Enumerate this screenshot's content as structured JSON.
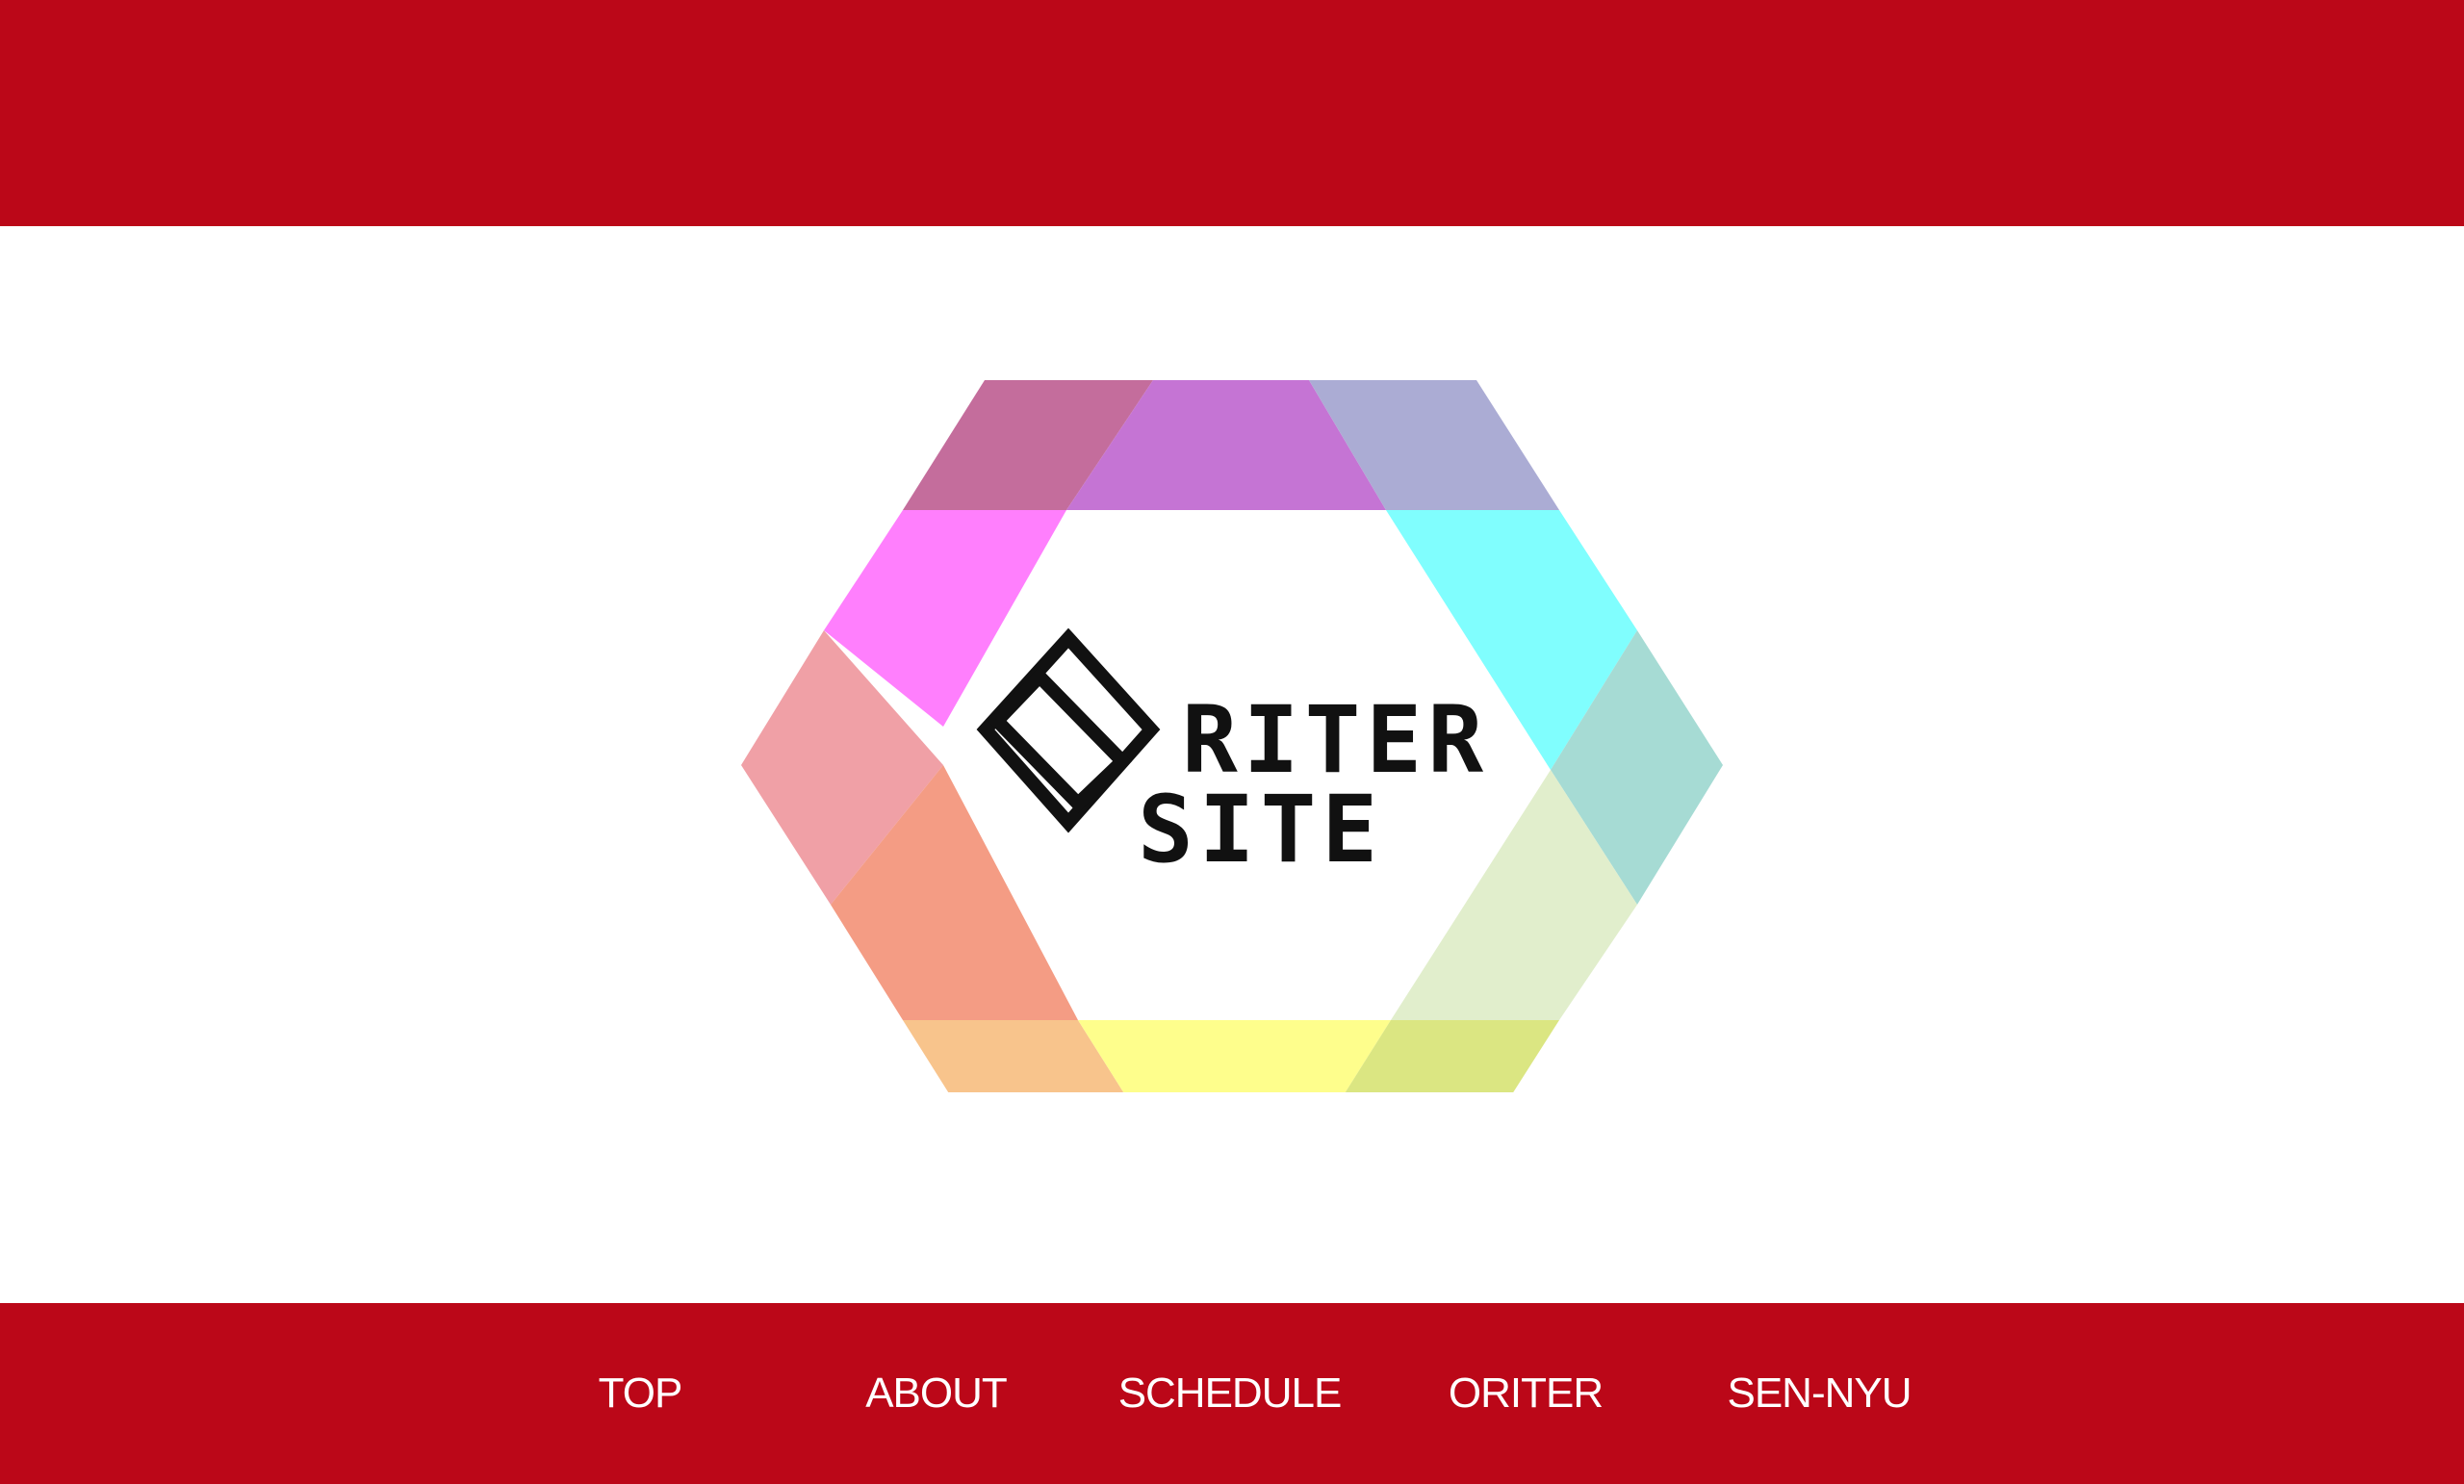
{
  "header": {
    "background_color": "#bb0718"
  },
  "logo": {
    "alt": "ORITER SITE",
    "line1": "RITER",
    "line2": "SITE",
    "palette": {
      "top_left": "#c46d9c",
      "top_center": "#c574d4",
      "top_right": "#abacd4",
      "upper_left": "#ff7ffd",
      "upper_right": "#80fefe",
      "left": "#f0a0a6",
      "right": "#a6dbd4",
      "lower_left": "#f49c84",
      "lower_right": "#e1eecc",
      "bottom_left": "#f8c48c",
      "bottom_center": "#fefe8c",
      "bottom_right": "#dbe682",
      "mark": "#111111"
    }
  },
  "nav": {
    "background_color": "#bb0718",
    "text_color": "#ffffff",
    "items": [
      {
        "label": "TOP"
      },
      {
        "label": "ABOUT"
      },
      {
        "label": "SCHEDULE"
      },
      {
        "label": "ORITER"
      },
      {
        "label": "SEN-NYU"
      }
    ]
  }
}
